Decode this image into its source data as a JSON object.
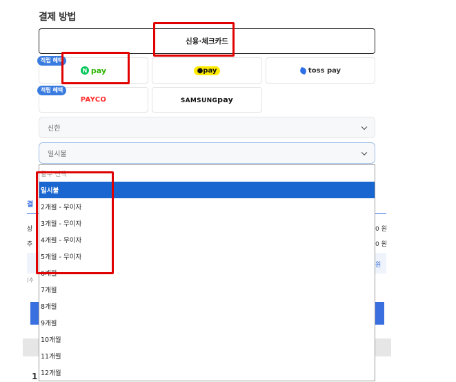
{
  "section_title": "결제 방법",
  "card_button": "신용·체크카드",
  "badges": {
    "npay": "적립 혜택",
    "payco": "적립 혜택"
  },
  "pay_methods": {
    "npay": {
      "letter": "N",
      "label": "pay"
    },
    "kakaopay": {
      "label": "pay"
    },
    "tosspay": {
      "label": "toss pay"
    },
    "payco": {
      "label": "PAYCO"
    },
    "samsungpay": {
      "brand": "SAMSUNG",
      "label": "pay"
    }
  },
  "card_select": {
    "value": "신한"
  },
  "installment_select": {
    "value": "일시불"
  },
  "dropdown": {
    "placeholder": "할부 선택",
    "options": [
      "일시불",
      "2개월 - 무이자",
      "3개월 - 무이자",
      "4개월 - 무이자",
      "5개월 - 무이자",
      "6개월",
      "7개월",
      "8개월",
      "9개월",
      "10개월",
      "11개월",
      "12개월"
    ],
    "selected_index": 0
  },
  "background": {
    "heading_fragment": "결",
    "row1_left": "상",
    "row1_right": "0 원",
    "row2_left": "추",
    "row2_right": "0 원",
    "note_left": "(추",
    "note_right": "원",
    "bottom_fragment": "1",
    "accent": "#3a6fe0"
  }
}
